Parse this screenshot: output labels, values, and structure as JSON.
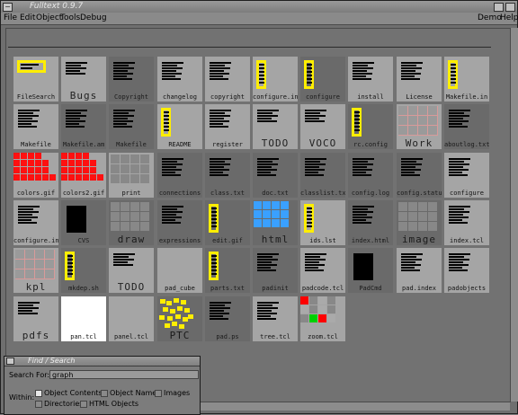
{
  "window": {
    "title": "Fulltext 0.9.7"
  },
  "menu": {
    "left": [
      "File",
      "Edit",
      "Object",
      "Tools",
      "Debug"
    ],
    "right": [
      "Demo",
      "Help"
    ]
  },
  "tiles": [
    {
      "label": "FileSearch",
      "style": "light",
      "kind": "box"
    },
    {
      "label": "Bugs",
      "style": "light",
      "kind": "lines",
      "big": true
    },
    {
      "label": "Copyright",
      "style": "dark",
      "kind": "lines"
    },
    {
      "label": "changelog",
      "style": "light",
      "kind": "lines"
    },
    {
      "label": "copyright",
      "style": "light",
      "kind": "lines"
    },
    {
      "label": "configure.in",
      "style": "light",
      "kind": "vbox"
    },
    {
      "label": "configure",
      "style": "dark",
      "kind": "vbox"
    },
    {
      "label": "install",
      "style": "light",
      "kind": "lines"
    },
    {
      "label": "License",
      "style": "light",
      "kind": "lines"
    },
    {
      "label": "Makefile.in",
      "style": "light",
      "kind": "vbox"
    },
    {
      "label": "Makefile",
      "style": "light",
      "kind": "lines"
    },
    {
      "label": "Makefile.am",
      "style": "dark",
      "kind": "lines"
    },
    {
      "label": "Makefile",
      "style": "dark",
      "kind": "lines"
    },
    {
      "label": "README",
      "style": "light",
      "kind": "vbox"
    },
    {
      "label": "register",
      "style": "light",
      "kind": "lines"
    },
    {
      "label": "TODO",
      "style": "light",
      "kind": "lines",
      "big": true
    },
    {
      "label": "VOCO",
      "style": "light",
      "kind": "lines",
      "big": true
    },
    {
      "label": "rc.config",
      "style": "dark",
      "kind": "vbox"
    },
    {
      "label": "Work",
      "style": "light",
      "kind": "pinkgrid",
      "big": true
    },
    {
      "label": "aboutlog.txt",
      "style": "dark",
      "kind": "lines"
    },
    {
      "label": "colors.gif",
      "style": "light",
      "kind": "red"
    },
    {
      "label": "colors2.gif",
      "style": "light",
      "kind": "red"
    },
    {
      "label": "print",
      "style": "light",
      "kind": "grid"
    },
    {
      "label": "connections",
      "style": "dark",
      "kind": "lines"
    },
    {
      "label": "class.txt",
      "style": "dark",
      "kind": "lines"
    },
    {
      "label": "doc.txt",
      "style": "dark",
      "kind": "lines"
    },
    {
      "label": "classlist.txt",
      "style": "dark",
      "kind": "lines"
    },
    {
      "label": "config.log",
      "style": "dark",
      "kind": "lines"
    },
    {
      "label": "config.status",
      "style": "dark",
      "kind": "lines"
    },
    {
      "label": "configure",
      "style": "light",
      "kind": "lines"
    },
    {
      "label": "configure.in",
      "style": "light",
      "kind": "lines"
    },
    {
      "label": "CVS",
      "style": "dark",
      "kind": "blackblock"
    },
    {
      "label": "draw",
      "style": "dark",
      "kind": "grid",
      "big": true
    },
    {
      "label": "expressions",
      "style": "dark",
      "kind": "lines"
    },
    {
      "label": "edit.gif",
      "style": "dark",
      "kind": "vbox"
    },
    {
      "label": "html",
      "style": "dark",
      "kind": "blue",
      "big": true
    },
    {
      "label": "ids.lst",
      "style": "light",
      "kind": "vbox"
    },
    {
      "label": "index.html",
      "style": "dark",
      "kind": "lines"
    },
    {
      "label": "image",
      "style": "dark",
      "kind": "grid",
      "big": true
    },
    {
      "label": "index.tcl",
      "style": "light",
      "kind": "lines"
    },
    {
      "label": "kpl",
      "style": "light",
      "kind": "pinkgrid",
      "big": true
    },
    {
      "label": "mkdep.sh",
      "style": "dark",
      "kind": "vbox"
    },
    {
      "label": "TODO",
      "style": "light",
      "kind": "lines",
      "big": true
    },
    {
      "label": "pad_cube",
      "style": "light",
      "kind": "plain"
    },
    {
      "label": "parts.txt",
      "style": "dark",
      "kind": "vbox"
    },
    {
      "label": "padinit",
      "style": "dark",
      "kind": "lines"
    },
    {
      "label": "padcode.tcl",
      "style": "light",
      "kind": "lines"
    },
    {
      "label": "PadCmd",
      "style": "dark",
      "kind": "blackblock"
    },
    {
      "label": "pad.index",
      "style": "light",
      "kind": "lines"
    },
    {
      "label": "padobjects",
      "style": "light",
      "kind": "lines"
    },
    {
      "label": "pdfs",
      "style": "light",
      "kind": "lines",
      "big": true
    },
    {
      "label": "pan.tcl",
      "style": "white",
      "kind": "plain"
    },
    {
      "label": "panel.tcl",
      "style": "light",
      "kind": "plain"
    },
    {
      "label": "PTC",
      "style": "dark",
      "kind": "yellow",
      "big": true
    },
    {
      "label": "pad.ps",
      "style": "dark",
      "kind": "lines"
    },
    {
      "label": "tree.tcl",
      "style": "light",
      "kind": "lines"
    },
    {
      "label": "zoom.tcl",
      "style": "light",
      "kind": "colorgrid"
    }
  ],
  "search_panel": {
    "title": "Find / Search",
    "search_label": "Search For:",
    "search_value": "graph",
    "within_label": "Within:",
    "options": [
      {
        "label": "Object Contents",
        "checked": true
      },
      {
        "label": "Object Name",
        "checked": false
      },
      {
        "label": "Images",
        "checked": false
      },
      {
        "label": "Directories",
        "checked": false
      },
      {
        "label": "HTML Objects",
        "checked": false
      }
    ]
  }
}
